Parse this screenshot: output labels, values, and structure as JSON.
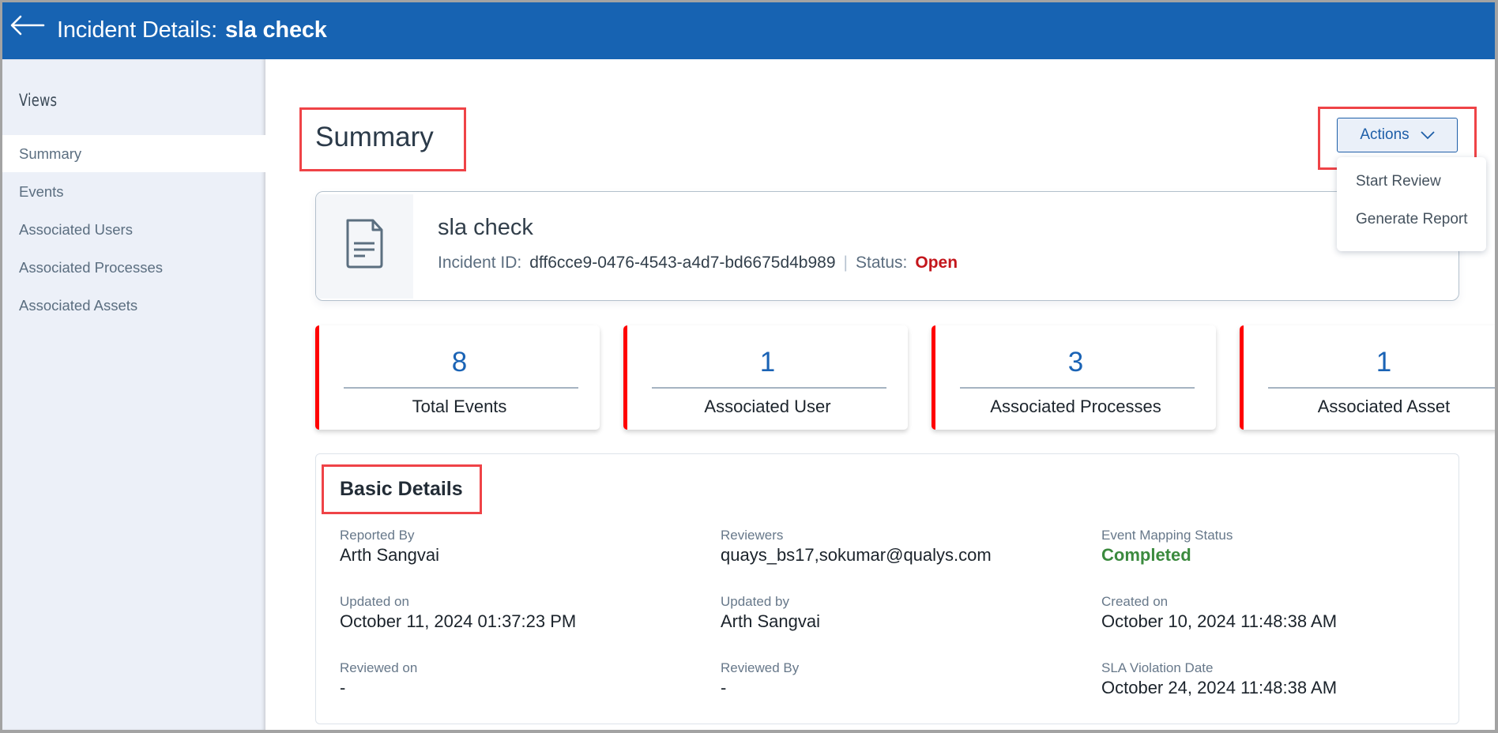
{
  "header": {
    "back_icon": "arrow-left-icon",
    "title_prefix": "Incident Details:",
    "title_name": "sla check",
    "color": "#1763b2"
  },
  "sidebar": {
    "title": "Views",
    "items": [
      {
        "label": "Summary",
        "active": true
      },
      {
        "label": "Events",
        "active": false
      },
      {
        "label": "Associated Users",
        "active": false
      },
      {
        "label": "Associated Processes",
        "active": false
      },
      {
        "label": "Associated Assets",
        "active": false
      }
    ]
  },
  "main": {
    "page_title": "Summary",
    "actions": {
      "label": "Actions",
      "icon": "chevron-down-icon",
      "menu": [
        "Start Review",
        "Generate Report"
      ]
    },
    "incident": {
      "icon": "document-icon",
      "name": "sla check",
      "id_label": "Incident ID:",
      "id_value": "dff6cce9-0476-4543-a4d7-bd6675d4b989",
      "separator": "|",
      "status_label": "Status:",
      "status_value": "Open",
      "status_color": "#c4161c"
    },
    "metrics": [
      {
        "value": "8",
        "label": "Total Events"
      },
      {
        "value": "1",
        "label": "Associated User"
      },
      {
        "value": "3",
        "label": "Associated Processes"
      },
      {
        "value": "1",
        "label": "Associated Asset"
      }
    ],
    "basic_details": {
      "title": "Basic Details",
      "fields": [
        {
          "label": "Reported By",
          "value": "Arth Sangvai"
        },
        {
          "label": "Reviewers",
          "value": "quays_bs17,sokumar@qualys.com"
        },
        {
          "label": "Event Mapping Status",
          "value": "Completed"
        },
        {
          "label": "Updated on",
          "value": "October 11, 2024 01:37:23 PM"
        },
        {
          "label": "Updated by",
          "value": "Arth Sangvai"
        },
        {
          "label": "Created on",
          "value": "October 10, 2024 11:48:38 AM"
        },
        {
          "label": "Reviewed on",
          "value": "-"
        },
        {
          "label": "Reviewed By",
          "value": "-"
        },
        {
          "label": "SLA Violation Date",
          "value": "October 24, 2024 11:48:38 AM"
        }
      ]
    }
  }
}
